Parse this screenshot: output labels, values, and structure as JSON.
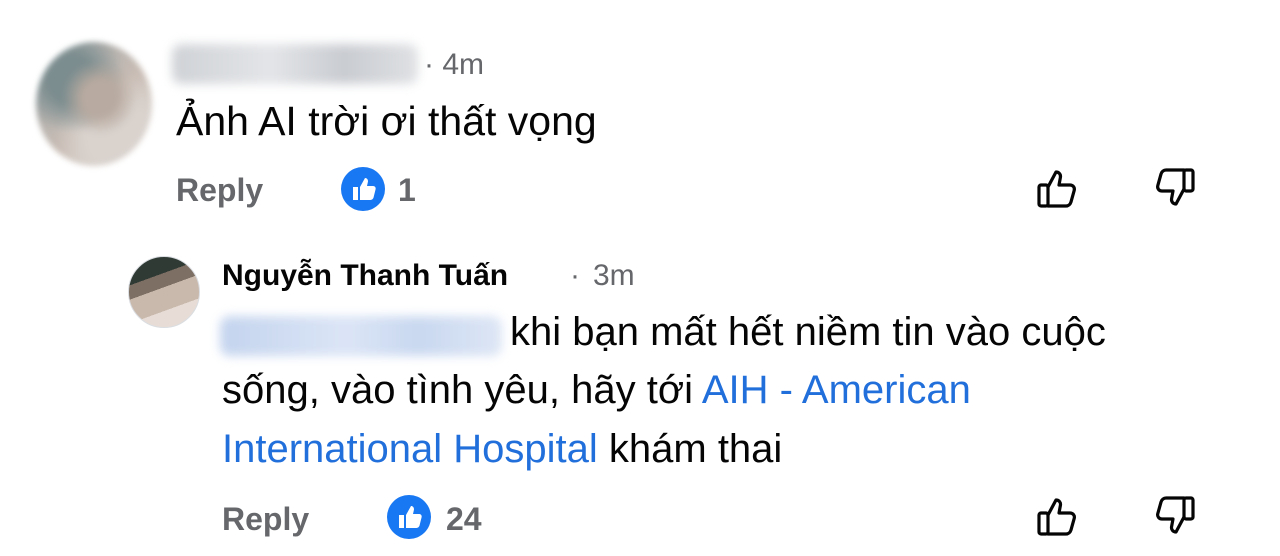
{
  "colors": {
    "text_primary": "#050505",
    "text_secondary": "#65676b",
    "link": "#216fdb",
    "like_blue": "#1877f2"
  },
  "comments": [
    {
      "author_name_blurred": true,
      "time": "· 4m",
      "text": "Ảnh AI trời ơi thất vọng",
      "reply_label": "Reply",
      "like_count": "1",
      "icons": [
        "like-bubble-icon",
        "thumbs-up-icon",
        "thumbs-down-icon"
      ]
    }
  ],
  "reply": {
    "author_name": "Nguyễn Thanh Tuấn",
    "dot": "·",
    "time": "3m",
    "mention_blurred": true,
    "text_line1": "khi bạn mất hết niềm tin vào cuộc",
    "text_line2_prefix": "sống, vào tình yêu, hãy tới ",
    "link_part1": "AIH - American",
    "link_part2": "International Hospital",
    "text_line3_suffix": " khám thai",
    "reply_label": "Reply",
    "like_count": "24"
  }
}
